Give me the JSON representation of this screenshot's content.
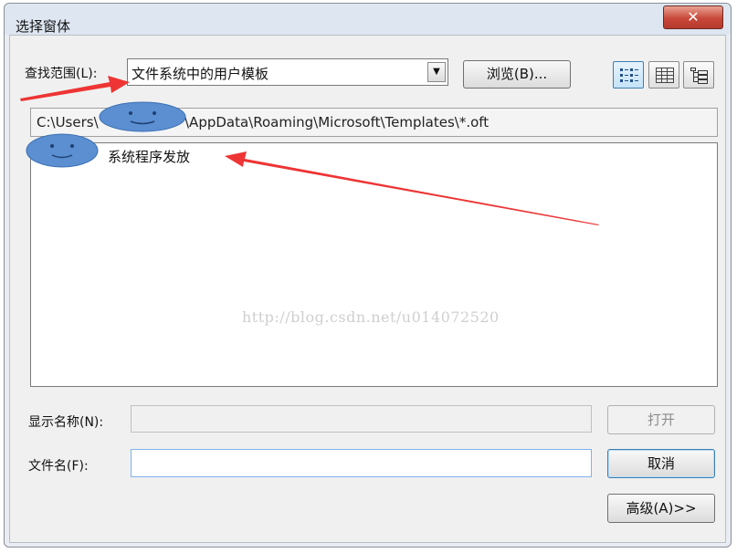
{
  "window": {
    "title": "选择窗体",
    "close_symbol": "✕"
  },
  "lookin": {
    "label": "查找范围(L):",
    "value": "文件系统中的用户模板",
    "dropdown_symbol": "▼"
  },
  "browse_button": {
    "label": "浏览(B)..."
  },
  "view_buttons": [
    {
      "name": "list-view-icon",
      "active": true
    },
    {
      "name": "details-view-icon",
      "active": false
    },
    {
      "name": "tree-view-icon",
      "active": false
    }
  ],
  "path": {
    "prefix": "C:\\Users\\",
    "suffix": "\\AppData\\Roaming\\Microsoft\\Templates\\*.oft"
  },
  "files": [
    {
      "name": "系统程序发放"
    }
  ],
  "watermark": "http://blog.csdn.net/u014072520",
  "display_name": {
    "label": "显示名称(N):",
    "value": ""
  },
  "filename": {
    "label": "文件名(F):",
    "value": ""
  },
  "buttons": {
    "open": "打开",
    "cancel": "取消",
    "advanced": "高级(A)>>"
  },
  "colors": {
    "titlebar": "#dde6f1",
    "close": "#c8483a",
    "blob_fill": "#5b8fd1",
    "arrow": "#ee3434"
  }
}
